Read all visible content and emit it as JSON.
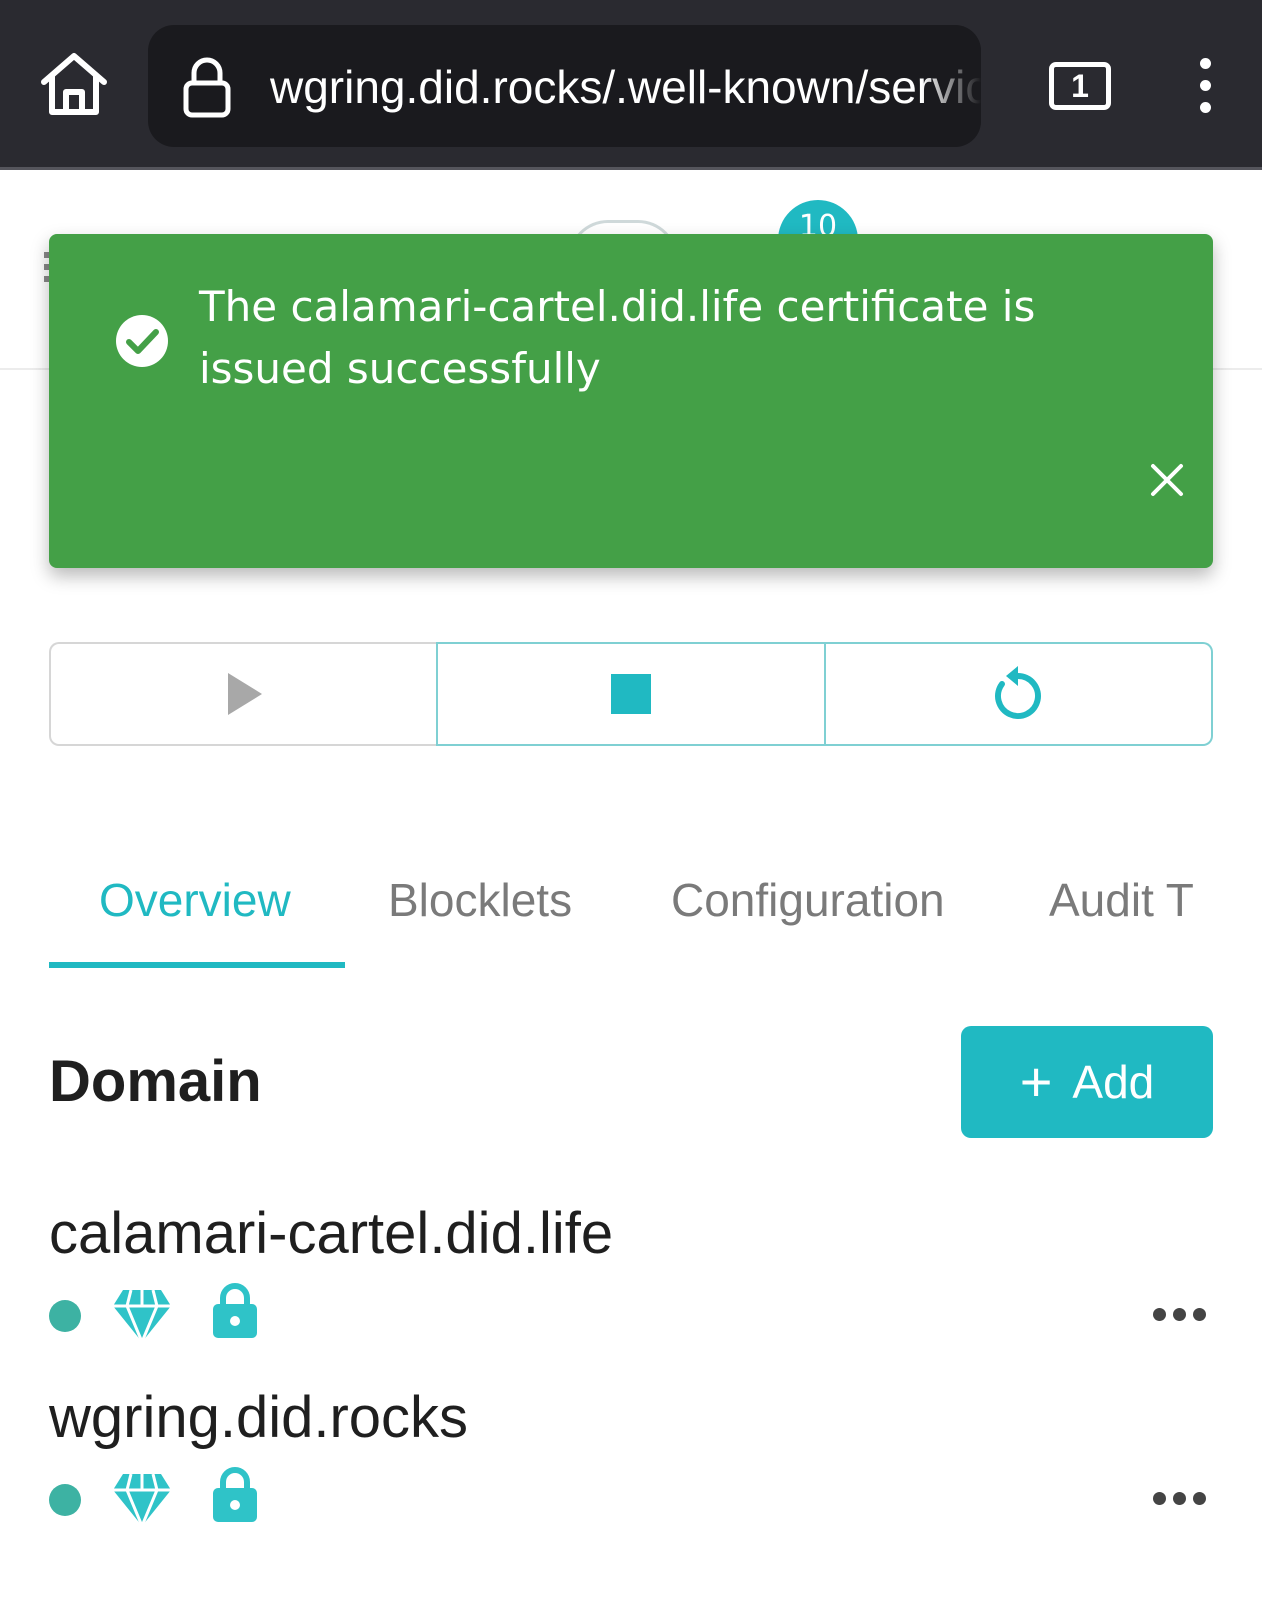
{
  "browser": {
    "url": "wgring.did.rocks/.well-known/service/admin/blocklets/...",
    "tab_count": "1"
  },
  "header": {
    "notification_count": "10"
  },
  "toast": {
    "message": "The calamari-cartel.did.life certificate is issued successfully",
    "background": "#44a047"
  },
  "controls": [
    {
      "name": "start",
      "icon": "play-icon"
    },
    {
      "name": "stop",
      "icon": "stop-icon"
    },
    {
      "name": "restart",
      "icon": "restart-icon"
    }
  ],
  "tabs": [
    {
      "label": "Overview",
      "active": true
    },
    {
      "label": "Blocklets",
      "active": false
    },
    {
      "label": "Configuration",
      "active": false
    },
    {
      "label": "Audit T",
      "active": false
    }
  ],
  "section": {
    "title": "Domain",
    "add_label": "Add"
  },
  "domains": [
    {
      "name": "calamari-cartel.did.life"
    },
    {
      "name": "wgring.did.rocks"
    }
  ],
  "colors": {
    "accent": "#20b9c2",
    "status_dot": "#3db2a3",
    "browser_bar": "#2a2a30"
  }
}
